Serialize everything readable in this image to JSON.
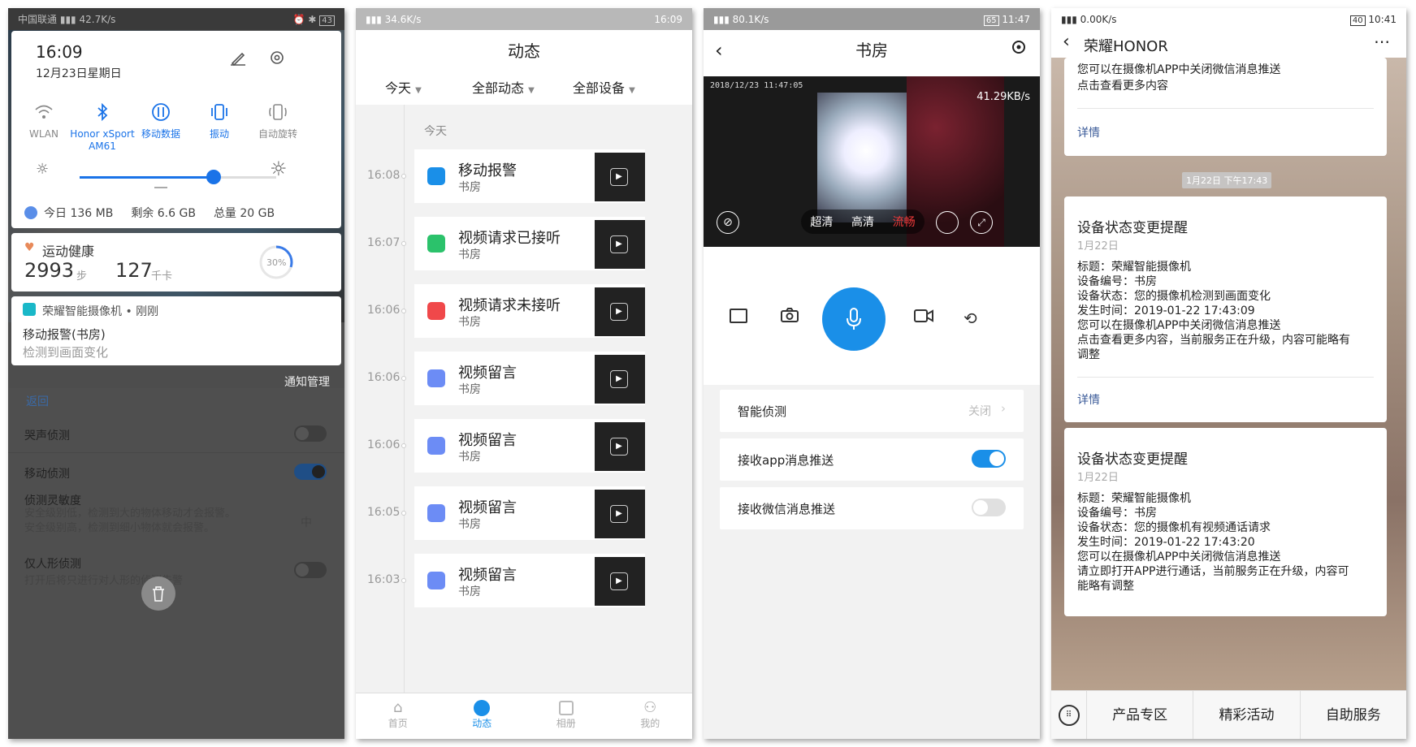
{
  "p1": {
    "status": {
      "carrier": "中国联通",
      "speed": "42.7K/s",
      "battery": "43"
    },
    "qs": {
      "time": "16:09",
      "date": "12月23日星期日",
      "tiles": [
        {
          "label": "WLAN",
          "icon": "wifi-icon"
        },
        {
          "label": "Honor xSport AM61",
          "icon": "bluetooth-icon"
        },
        {
          "label": "移动数据",
          "icon": "mobile-data-icon"
        },
        {
          "label": "振动",
          "icon": "vibrate-icon"
        },
        {
          "label": "自动旋转",
          "icon": "auto-rotate-icon"
        }
      ],
      "brightness": 0.68
    },
    "data_usage": {
      "today": "今日 136 MB",
      "remain": "剩余 6.6 GB",
      "total": "总量 20 GB"
    },
    "health": {
      "title": "运动健康",
      "steps": "2993",
      "steps_unit": "步",
      "cal": "127",
      "cal_unit": "千卡",
      "progress_label": "30%",
      "progress": 0.3
    },
    "notif": {
      "app": "荣耀智能摄像机 • 刚刚",
      "title": "移动报警(书房)",
      "body": "检测到画面变化"
    },
    "manage": "通知管理",
    "settings": {
      "back": "返回",
      "cry": "哭声侦测",
      "motion": "移动侦测",
      "sens_title": "侦测灵敏度",
      "sens_desc": "安全级别低，检测到大的物体移动才会报警。安全级别高，检测到细小物体就会报警。",
      "sens_val": "中",
      "human": "仅人形侦测",
      "human_desc": "打开后将只进行对人形的侦测告警"
    }
  },
  "p2": {
    "status": {
      "speed": "34.6K/s",
      "time": "16:09"
    },
    "title": "动态",
    "filters": [
      "今天",
      "全部动态",
      "全部设备"
    ],
    "section": "今天",
    "events": [
      {
        "time": "16:08",
        "title": "移动报警",
        "room": "书房",
        "color": "#1a8fe8"
      },
      {
        "time": "16:07",
        "title": "视频请求已接听",
        "room": "书房",
        "color": "#2bc26b"
      },
      {
        "time": "16:06",
        "title": "视频请求未接听",
        "room": "书房",
        "color": "#f0484a"
      },
      {
        "time": "16:06",
        "title": "视频留言",
        "room": "书房",
        "color": "#6c8cf5"
      },
      {
        "time": "16:06",
        "title": "视频留言",
        "room": "书房",
        "color": "#6c8cf5"
      },
      {
        "time": "16:05",
        "title": "视频留言",
        "room": "书房",
        "color": "#6c8cf5"
      },
      {
        "time": "16:03",
        "title": "视频留言",
        "room": "书房",
        "color": "#6c8cf5"
      }
    ],
    "tabs": [
      "首页",
      "动态",
      "相册",
      "我的"
    ]
  },
  "p3": {
    "status": {
      "speed": "80.1K/s",
      "battery": "65",
      "time": "11:47"
    },
    "title": "书房",
    "timestamp": "2018/12/23  11:47:05",
    "bitrate": "41.29KB/s",
    "quality": [
      "超清",
      "高清",
      "流畅"
    ],
    "rows": [
      {
        "label": "智能侦测",
        "value": "关闭"
      },
      {
        "label": "接收app消息推送"
      },
      {
        "label": "接收微信消息推送"
      }
    ]
  },
  "p4": {
    "status": {
      "speed": "0.00K/s",
      "battery": "40",
      "time": "10:41"
    },
    "title": "荣耀HONOR",
    "top_msg": {
      "line1": "您可以在摄像机APP中关闭微信消息推送",
      "line2": "点击查看更多内容",
      "detail": "详情"
    },
    "date_badge": "1月22日 下午17:43",
    "msgs": [
      {
        "title": "设备状态变更提醒",
        "date": "1月22日",
        "lines": [
          "标题：荣耀智能摄像机",
          "设备编号：书房",
          "设备状态：您的摄像机检测到画面变化",
          "发生时间：2019-01-22 17:43:09",
          "您可以在摄像机APP中关闭微信消息推送",
          "点击查看更多内容，当前服务正在升级，内容可能略有调整"
        ],
        "detail": "详情"
      },
      {
        "title": "设备状态变更提醒",
        "date": "1月22日",
        "lines": [
          "标题：荣耀智能摄像机",
          "设备编号：书房",
          "设备状态：您的摄像机有视频通话请求",
          "发生时间：2019-01-22 17:43:20",
          "您可以在摄像机APP中关闭微信消息推送",
          "请立即打开APP进行通话，当前服务正在升级，内容可能略有调整"
        ]
      }
    ],
    "menu": [
      "产品专区",
      "精彩活动",
      "自助服务"
    ]
  }
}
